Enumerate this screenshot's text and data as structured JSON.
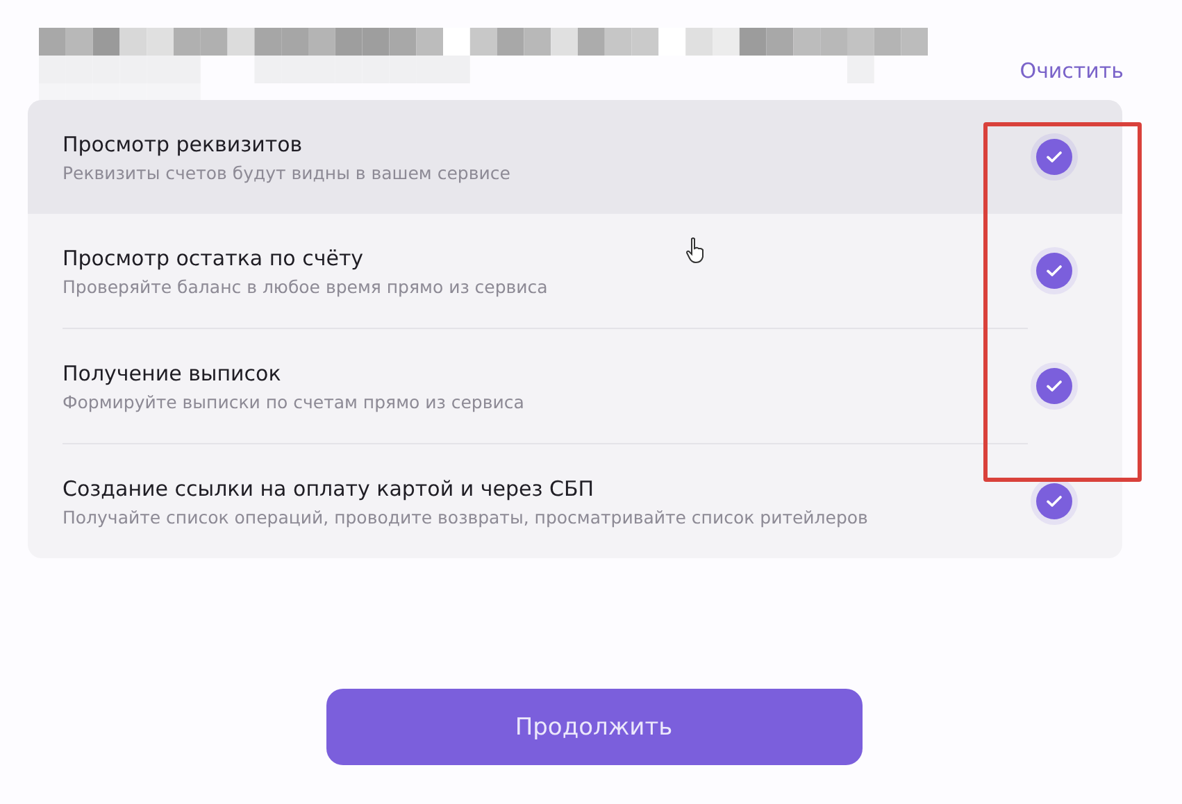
{
  "clear_link": {
    "label": "Очистить"
  },
  "permissions": [
    {
      "title": "Просмотр реквизитов",
      "description": "Реквизиты счетов будут видны в вашем сервисе",
      "checked": true,
      "hovered": true
    },
    {
      "title": "Просмотр остатка по счёту",
      "description": "Проверяйте баланс в любое время прямо из сервиса",
      "checked": true,
      "hovered": false
    },
    {
      "title": "Получение выписок",
      "description": "Формируйте выписки по счетам прямо из сервиса",
      "checked": true,
      "hovered": false
    },
    {
      "title": "Создание ссылки на оплату картой и через СБП",
      "description": "Получайте список операций, проводите возвраты, просматривайте список ритейлеров",
      "checked": true,
      "hovered": false
    }
  ],
  "continue_button": {
    "label": "Продолжить"
  }
}
